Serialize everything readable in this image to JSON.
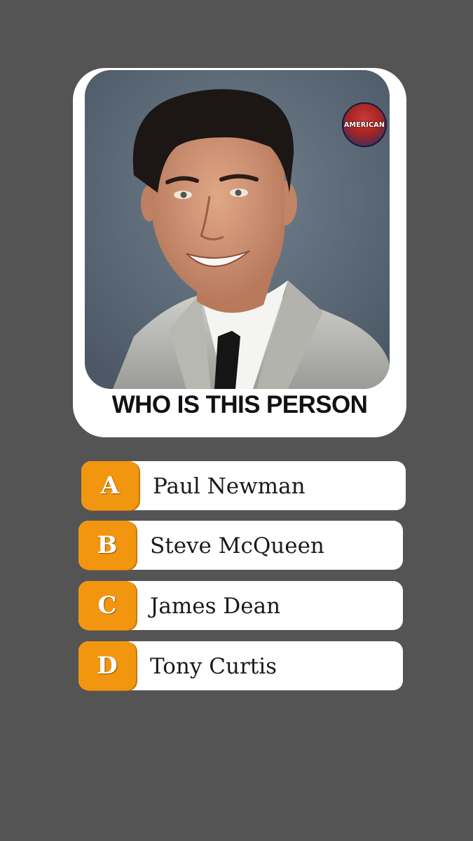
{
  "question": "WHO IS THIS PERSON",
  "badge": {
    "text": "AMERICAN",
    "icon": "american-iq-logo"
  },
  "colors": {
    "background": "#545454",
    "card": "#ffffff",
    "letter_badge": "#f2960f"
  },
  "options": [
    {
      "letter": "A",
      "label": "Paul Newman"
    },
    {
      "letter": "B",
      "label": "Steve McQueen"
    },
    {
      "letter": "C",
      "label": "James Dean"
    },
    {
      "letter": "D",
      "label": "Tony Curtis"
    }
  ]
}
